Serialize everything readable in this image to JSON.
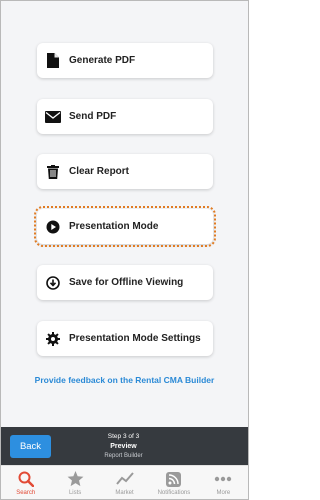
{
  "actions": [
    {
      "label": "Generate PDF",
      "icon": "file-icon"
    },
    {
      "label": "Send PDF",
      "icon": "envelope-icon"
    },
    {
      "label": "Clear Report",
      "icon": "trash-icon"
    },
    {
      "label": "Presentation Mode",
      "icon": "play-circle-icon"
    },
    {
      "label": "Save for Offline Viewing",
      "icon": "download-circle-icon"
    },
    {
      "label": "Presentation Mode Settings",
      "icon": "gear-icon"
    }
  ],
  "feedback_link": "Provide feedback on the Rental CMA Builder",
  "wizard": {
    "back_label": "Back",
    "step": "Step 3 of 3",
    "title": "Preview",
    "subtitle": "Report Builder"
  },
  "tabs": [
    {
      "label": "Search",
      "icon": "search-icon",
      "active": true
    },
    {
      "label": "Lists",
      "icon": "star-icon",
      "active": false
    },
    {
      "label": "Market",
      "icon": "trend-line-icon",
      "active": false
    },
    {
      "label": "Notifications",
      "icon": "rss-icon",
      "active": false
    },
    {
      "label": "More",
      "icon": "more-dots-icon",
      "active": false
    }
  ],
  "colors": {
    "accent": "#2d8fe0",
    "link": "#2b8ad6",
    "active_tab": "#e24a35",
    "focus_outline": "#e07b22",
    "wizard_bar": "#363a3f"
  }
}
